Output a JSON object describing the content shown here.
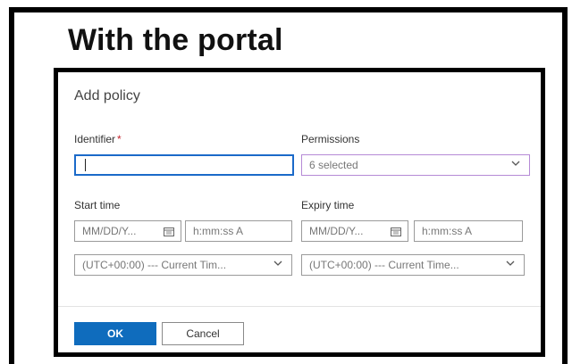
{
  "slide": {
    "title": "With the portal"
  },
  "dialog": {
    "title": "Add policy",
    "identifier": {
      "label": "Identifier",
      "required_mark": "*",
      "value": ""
    },
    "permissions": {
      "label": "Permissions",
      "value": "6 selected"
    },
    "start_time": {
      "label": "Start time",
      "date_placeholder": "MM/DD/Y...",
      "time_placeholder": "h:mm:ss A",
      "timezone": "(UTC+00:00) --- Current Tim..."
    },
    "expiry_time": {
      "label": "Expiry time",
      "date_placeholder": "MM/DD/Y...",
      "time_placeholder": "h:mm:ss A",
      "timezone": "(UTC+00:00) --- Current Time..."
    },
    "buttons": {
      "ok": "OK",
      "cancel": "Cancel"
    }
  },
  "colors": {
    "primary_button": "#0f6cbd",
    "focus_border": "#1b6ac9",
    "required_mark": "#c4262e",
    "permissions_border": "#b58ad6"
  },
  "icons": [
    "calendar-icon",
    "chevron-down-icon"
  ]
}
